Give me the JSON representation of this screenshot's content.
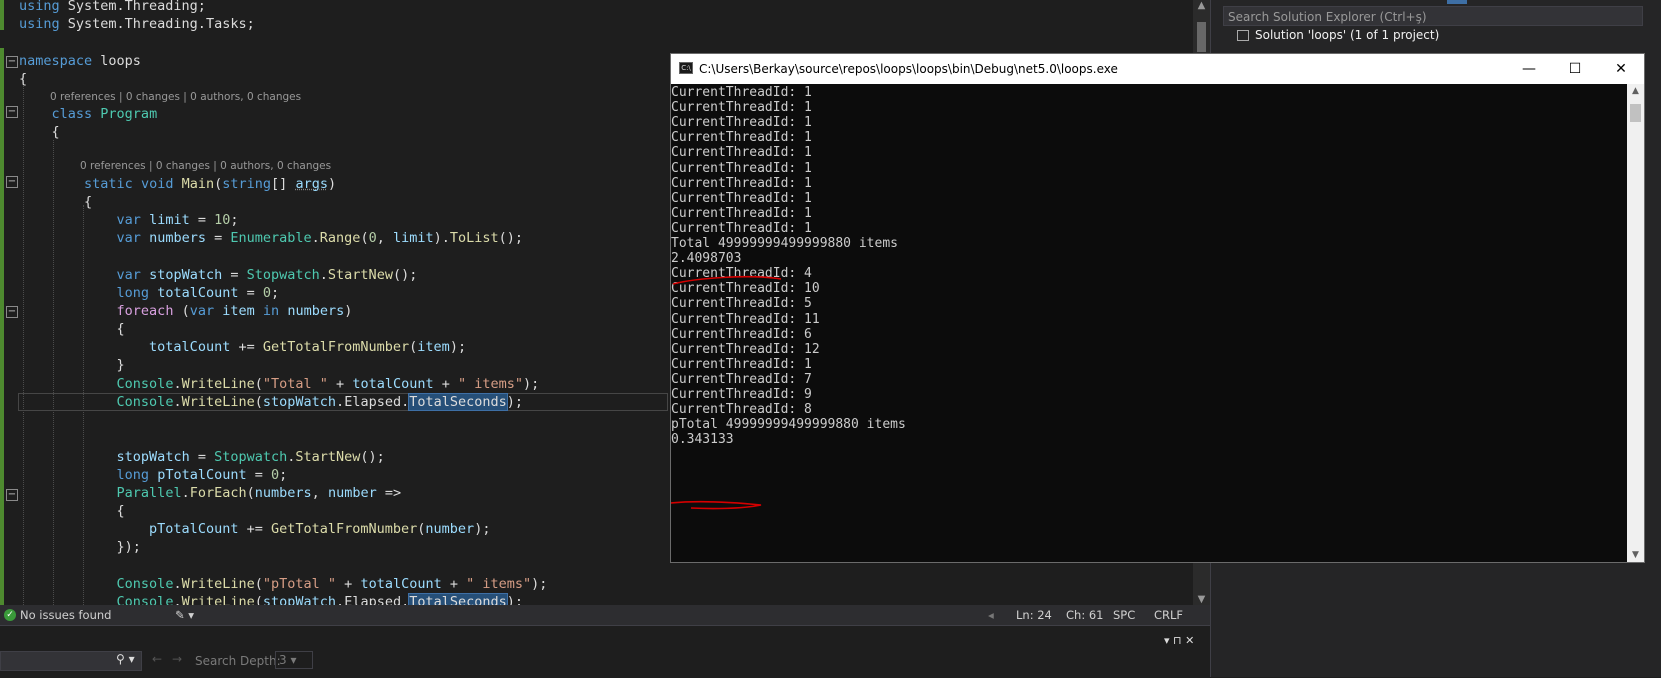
{
  "editor": {
    "lines": [
      {
        "t": "using",
        "rest": " System.Threading;"
      },
      {
        "t": "using",
        "rest": " System.Threading.Tasks;"
      }
    ],
    "namespace_kw": "namespace",
    "namespace_name": " loops",
    "brace_open": "{",
    "codelens_class": "0 references | 0 changes | 0 authors, 0 changes",
    "class_kw": "class",
    "class_name": "Program",
    "codelens_main": "0 references | 0 changes | 0 authors, 0 changes",
    "main_static": "static",
    "main_void": "void",
    "main_name": "Main",
    "main_string": "string",
    "main_args": "args",
    "var_kw": "var",
    "limit_name": "limit",
    "limit_value": "10",
    "numbers_name": "numbers",
    "enumerable": "Enumerable",
    "range_fn": "Range",
    "tolist_fn": "ToList",
    "stopwatch_name": "stopWatch",
    "stopwatch_type": "Stopwatch",
    "startnew_fn": "StartNew",
    "long_kw": "long",
    "totalcount_name": "totalCount",
    "zero": "0",
    "foreach_kw": "foreach",
    "item_name": "item",
    "in_kw": "in",
    "gettotal_fn": "GetTotalFromNumber",
    "console_type": "Console",
    "writeline_fn": "WriteLine",
    "str_total": "\"Total \"",
    "str_items": "\" items\"",
    "elapsed": "Elapsed",
    "totalseconds": "TotalSeconds",
    "ptotalcount_name": "pTotalCount",
    "parallel_type": "Parallel",
    "foreach_fn": "ForEach",
    "number_name": "number",
    "str_ptotal": "\"pTotal \""
  },
  "statusbar": {
    "issues": "No issues found",
    "ln": "Ln: 24",
    "ch": "Ch: 61",
    "spc": "SPC",
    "crlf": "CRLF"
  },
  "bottom_panel": {
    "search_depth_label": "Search Depth:",
    "search_depth_value": "3"
  },
  "solution_explorer": {
    "search_placeholder": "Search Solution Explorer (Ctrl+ş)",
    "solution_label": "Solution 'loops' (1 of 1 project)"
  },
  "console": {
    "title": "C:\\Users\\Berkay\\source\\repos\\loops\\loops\\bin\\Debug\\net5.0\\loops.exe",
    "lines": [
      "CurrentThreadId: 1",
      "CurrentThreadId: 1",
      "CurrentThreadId: 1",
      "CurrentThreadId: 1",
      "CurrentThreadId: 1",
      "CurrentThreadId: 1",
      "CurrentThreadId: 1",
      "CurrentThreadId: 1",
      "CurrentThreadId: 1",
      "CurrentThreadId: 1",
      "Total 49999999499999880 items",
      "2.4098703",
      "CurrentThreadId: 4",
      "CurrentThreadId: 10",
      "CurrentThreadId: 5",
      "CurrentThreadId: 11",
      "CurrentThreadId: 6",
      "CurrentThreadId: 12",
      "CurrentThreadId: 1",
      "CurrentThreadId: 7",
      "CurrentThreadId: 9",
      "CurrentThreadId: 8",
      "pTotal 49999999499999880 items",
      "0.343133"
    ],
    "annotation_color": "#d40000"
  }
}
